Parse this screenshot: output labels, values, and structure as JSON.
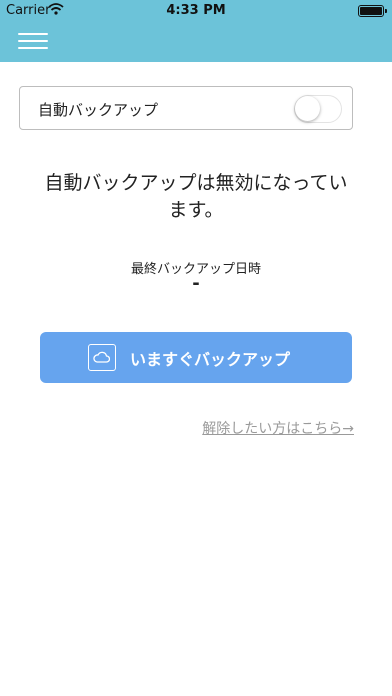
{
  "status_bar": {
    "carrier": "Carrier",
    "time": "4:33 PM"
  },
  "colors": {
    "nav_bar": "#6cc3d9",
    "primary_button": "#66a4ee",
    "link": "#9a9a9a"
  },
  "auto_backup": {
    "label": "自動バックアップ",
    "enabled": false
  },
  "status_message": "自動バックアップは無効になっています。",
  "last_backup": {
    "label": "最終バックアップ日時",
    "value": "-"
  },
  "backup_button": {
    "label": "いますぐバックアップ",
    "icon": "cloud-icon"
  },
  "release_link": "解除したい方はこちら→"
}
